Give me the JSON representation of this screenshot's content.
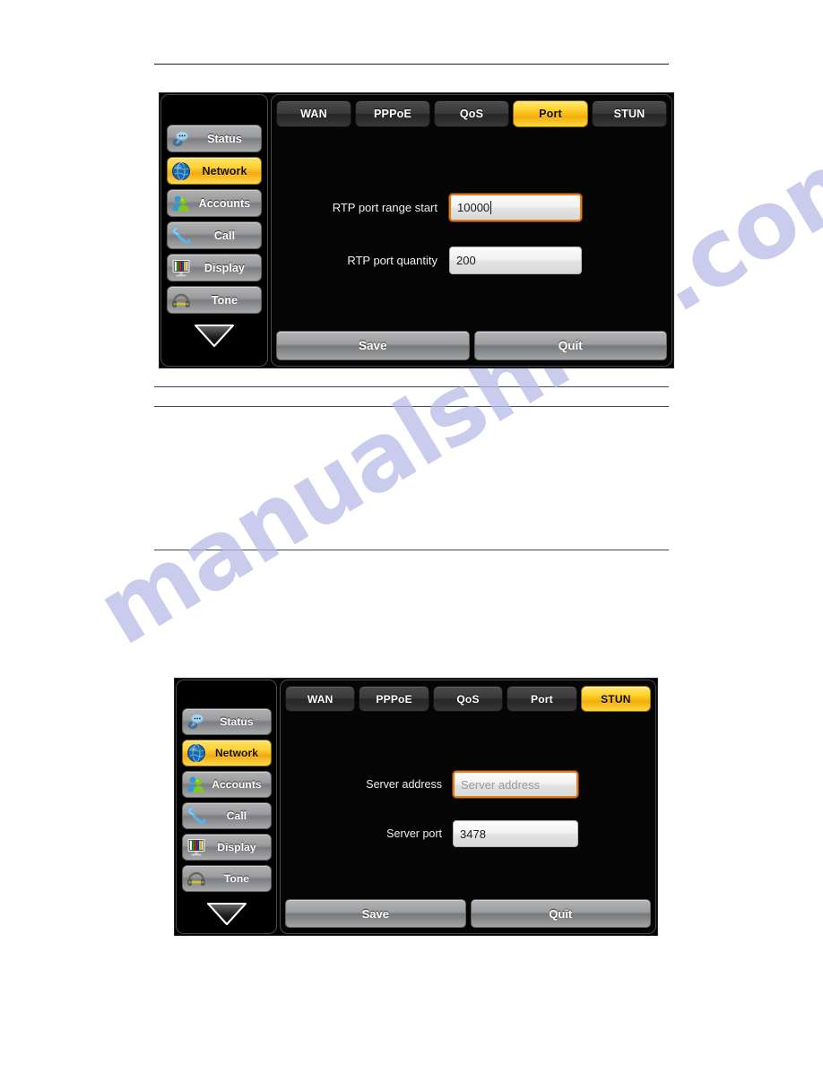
{
  "watermark": {
    "text": "manualshive.com"
  },
  "screens": [
    {
      "id": "port-screen",
      "sidebar": {
        "items": [
          {
            "label": "Status",
            "icon": "chat-bubbles-icon",
            "active": false
          },
          {
            "label": "Network",
            "icon": "globe-icon",
            "active": true
          },
          {
            "label": "Accounts",
            "icon": "people-icon",
            "active": false
          },
          {
            "label": "Call",
            "icon": "phone-handset-icon",
            "active": false
          },
          {
            "label": "Display",
            "icon": "monitor-icon",
            "active": false
          },
          {
            "label": "Tone",
            "icon": "headphones-icon",
            "active": false
          }
        ],
        "scroll_icon": "triangle-down-icon"
      },
      "tabs": [
        {
          "label": "WAN",
          "active": false
        },
        {
          "label": "PPPoE",
          "active": false
        },
        {
          "label": "QoS",
          "active": false
        },
        {
          "label": "Port",
          "active": true
        },
        {
          "label": "STUN",
          "active": false
        }
      ],
      "fields": [
        {
          "label": "RTP port range start",
          "value": "10000",
          "placeholder": "",
          "focused": true,
          "caret": true
        },
        {
          "label": "RTP port quantity",
          "value": "200",
          "placeholder": "",
          "focused": false,
          "caret": false
        }
      ],
      "actions": [
        {
          "label": "Save"
        },
        {
          "label": "Quit"
        }
      ]
    },
    {
      "id": "stun-screen",
      "sidebar": {
        "items": [
          {
            "label": "Status",
            "icon": "chat-bubbles-icon",
            "active": false
          },
          {
            "label": "Network",
            "icon": "globe-icon",
            "active": true
          },
          {
            "label": "Accounts",
            "icon": "people-icon",
            "active": false
          },
          {
            "label": "Call",
            "icon": "phone-handset-icon",
            "active": false
          },
          {
            "label": "Display",
            "icon": "monitor-icon",
            "active": false
          },
          {
            "label": "Tone",
            "icon": "headphones-icon",
            "active": false
          }
        ],
        "scroll_icon": "triangle-down-icon"
      },
      "tabs": [
        {
          "label": "WAN",
          "active": false
        },
        {
          "label": "PPPoE",
          "active": false
        },
        {
          "label": "QoS",
          "active": false
        },
        {
          "label": "Port",
          "active": false
        },
        {
          "label": "STUN",
          "active": true
        }
      ],
      "fields": [
        {
          "label": "Server address",
          "value": "",
          "placeholder": "Server address",
          "focused": true,
          "caret": false
        },
        {
          "label": "Server port",
          "value": "3478",
          "placeholder": "",
          "focused": false,
          "caret": false
        }
      ],
      "actions": [
        {
          "label": "Save"
        },
        {
          "label": "Quit"
        }
      ]
    }
  ],
  "colors": {
    "accent_yellow": "#ffd42e",
    "focus_orange": "#e07b1e",
    "panel_black": "#000000",
    "rule_dark": "#1d1d1d",
    "rule_blue": "#3a4a5a",
    "watermark": "#b9bbe8"
  }
}
